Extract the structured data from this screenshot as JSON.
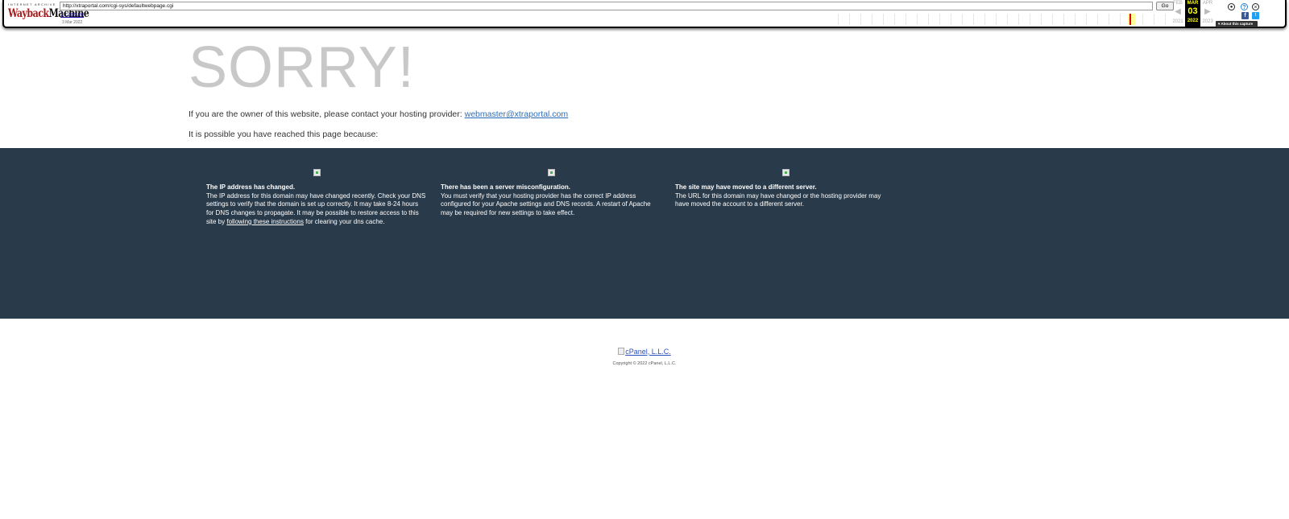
{
  "wayback": {
    "logo_top": "INTERNET ARCHIVE",
    "logo_wayback": "Wayback",
    "logo_machine": "Machine",
    "url": "http://xtraportal.com/cgi-sys/defaultwebpage.cgi",
    "go_label": "Go",
    "captures": "1 capture",
    "capture_date": "3 Mar 2022",
    "prev_month": "FEB",
    "prev_year": "2021",
    "current_month": "MAR",
    "current_day": "03",
    "current_year": "2022",
    "next_month": "APR",
    "next_year": "2023",
    "about": "About this capture",
    "icons": [
      "user-icon",
      "help-icon",
      "close-icon",
      "facebook-icon",
      "twitter-icon"
    ]
  },
  "main": {
    "heading": "SORRY!",
    "owner_text": "If you are the owner of this website, please contact your hosting provider: ",
    "owner_email": "webmaster@xtraportal.com",
    "reason_text": "It is possible you have reached this page because:"
  },
  "reasons": [
    {
      "title": "The IP address has changed.",
      "body": "The IP address for this domain may have changed recently. Check your DNS settings to verify that the domain is set up correctly. It may take 8-24 hours for DNS changes to propagate. It may be possible to restore access to this site by ",
      "link": "following these instructions",
      "tail": " for clearing your dns cache."
    },
    {
      "title": "There has been a server misconfiguration.",
      "body": "You must verify that your hosting provider has the correct IP address configured for your Apache settings and DNS records. A restart of Apache may be required for new settings to take effect."
    },
    {
      "title": "The site may have moved to a different server.",
      "body": "The URL for this domain may have changed or the hosting provider may have moved the account to a different server."
    }
  ],
  "footer": {
    "logo_alt": "cPanel, L.L.C.",
    "copyright": "Copyright © 2022 cPanel, L.L.C."
  },
  "colors": {
    "band": "#293a4a",
    "heading": "#c8c8c8",
    "link": "#2a6ebb",
    "timeline_marker": "#dd0000"
  }
}
